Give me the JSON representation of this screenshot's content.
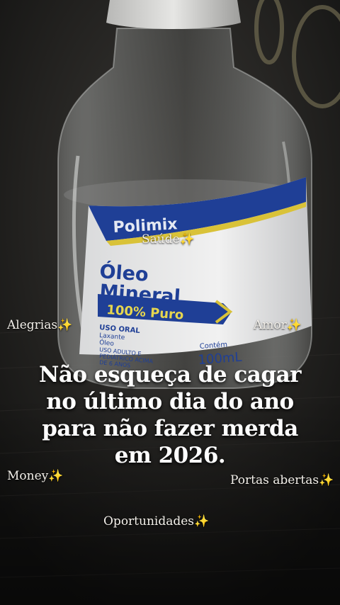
{
  "photo": {
    "label_brand": "Polimix",
    "label_product_line1": "Óleo",
    "label_product_line2": "Mineral",
    "label_badge": "100% Puro",
    "label_use1": "USO ORAL",
    "label_use2": "Laxante",
    "label_use3": "Óleo",
    "label_use4": "USO ADULTO E",
    "label_use5": "PEDIÁTRICO ACIMA",
    "label_use6": "DE 6 ANOS",
    "label_content_title": "Contém",
    "label_content_value": "100mL",
    "label_blue": "#1f3f96",
    "label_yellow": "#d9c238"
  },
  "headline": {
    "line1": "Não esqueça de cagar",
    "line2": "no último dia do ano",
    "line3": "para não fazer merda",
    "line4": "em 2026."
  },
  "captions": {
    "saude": "Saúde",
    "alegrias": "Alegrias",
    "amor": "Amor",
    "money": "Money",
    "portas": "Portas abertas",
    "oportunidades": "Oportunidades",
    "sparkle": "✨"
  }
}
